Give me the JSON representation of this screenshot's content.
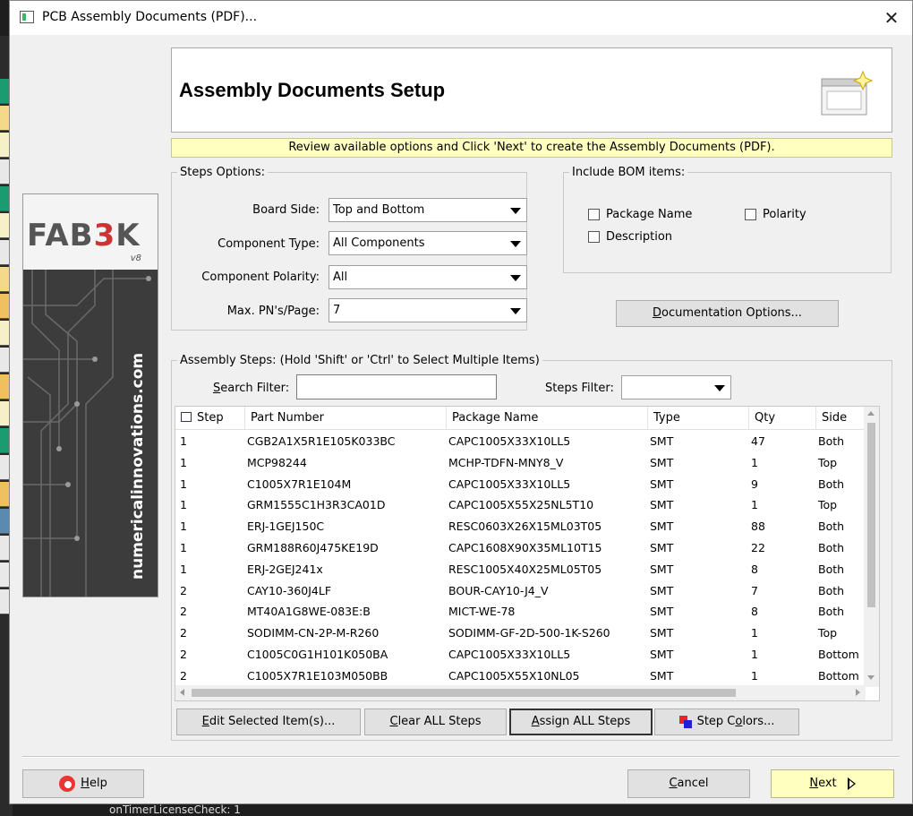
{
  "window": {
    "title": "PCB Assembly Documents (PDF)..."
  },
  "header": {
    "title": "Assembly Documents Setup"
  },
  "info_bar": "Review available options and Click 'Next' to create the Assembly Documents (PDF).",
  "logo": {
    "brand_a": "FAB",
    "brand_b": "3",
    "brand_c": "K",
    "version": "v8",
    "site": "numericalinnovations.com"
  },
  "steps_options": {
    "legend": "Steps Options:",
    "fields": [
      {
        "label": "Board Side:",
        "value": "Top and Bottom"
      },
      {
        "label": "Component Type:",
        "value": "All Components"
      },
      {
        "label": "Component Polarity:",
        "value": "All"
      },
      {
        "label": "Max. PN's/Page:",
        "value": "7"
      }
    ]
  },
  "bom": {
    "legend": "Include BOM items:",
    "package_name": "Package Name",
    "polarity": "Polarity",
    "description": "Description"
  },
  "doc_options_btn": {
    "pre": "",
    "key": "D",
    "post": "ocumentation Options..."
  },
  "assembly": {
    "legend": "Assembly Steps:  (Hold 'Shift' or 'Ctrl' to Select Multiple Items)",
    "search_label_key": "S",
    "search_label_rest": "earch Filter:",
    "search_value": "",
    "steps_filter_label": "Steps Filter:",
    "steps_filter_value": ""
  },
  "table": {
    "columns": [
      "Step",
      "Part Number",
      "Package Name",
      "Type",
      "Qty",
      "Side"
    ],
    "rows": [
      [
        "1",
        "CGB2A1X5R1E105K033BC",
        "CAPC1005X33X10LL5",
        "SMT",
        "47",
        "Both"
      ],
      [
        "1",
        "MCP98244",
        "MCHP-TDFN-MNY8_V",
        "SMT",
        "1",
        "Top"
      ],
      [
        "1",
        "C1005X7R1E104M",
        "CAPC1005X33X10LL5",
        "SMT",
        "9",
        "Both"
      ],
      [
        "1",
        "GRM1555C1H3R3CA01D",
        "CAPC1005X55X25NL5T10",
        "SMT",
        "1",
        "Top"
      ],
      [
        "1",
        "ERJ-1GEJ150C",
        "RESC0603X26X15ML03T05",
        "SMT",
        "88",
        "Both"
      ],
      [
        "1",
        "GRM188R60J475KE19D",
        "CAPC1608X90X35ML10T15",
        "SMT",
        "22",
        "Both"
      ],
      [
        "1",
        "ERJ-2GEJ241x",
        "RESC1005X40X25ML05T05",
        "SMT",
        "8",
        "Both"
      ],
      [
        "2",
        "CAY10-360J4LF",
        "BOUR-CAY10-J4_V",
        "SMT",
        "7",
        "Both"
      ],
      [
        "2",
        "MT40A1G8WE-083E:B",
        "MICT-WE-78",
        "SMT",
        "8",
        "Both"
      ],
      [
        "2",
        "SODIMM-CN-2P-M-R260",
        "SODIMM-GF-2D-500-1K-S260",
        "SMT",
        "1",
        "Top"
      ],
      [
        "2",
        "C1005C0G1H101K050BA",
        "CAPC1005X33X10LL5",
        "SMT",
        "1",
        "Bottom"
      ],
      [
        "2",
        "C1005X7R1E103M050BB",
        "CAPC1005X55X10NL05",
        "SMT",
        "1",
        "Bottom"
      ]
    ]
  },
  "buttons": {
    "edit": {
      "key": "E",
      "rest": "dit Selected Item(s)..."
    },
    "clear": {
      "key": "C",
      "rest": "lear ALL Steps"
    },
    "assign": {
      "key": "A",
      "rest": "ssign ALL Steps"
    },
    "colors_pre": "Step C",
    "colors_key": "o",
    "colors_rest": "lors...",
    "help": {
      "key": "H",
      "rest": "elp"
    },
    "cancel": {
      "key": "C",
      "rest": "ancel"
    },
    "next": {
      "key": "N",
      "rest": "ext"
    }
  },
  "background": {
    "status_text": "onTimerLicenseCheck: 1"
  },
  "icons": {
    "close": "close-icon",
    "app": "app-icon",
    "wizard": "wizard-icon",
    "help": "help-icon",
    "step_colors": "color-squares-icon",
    "next": "arrow-right-icon"
  }
}
